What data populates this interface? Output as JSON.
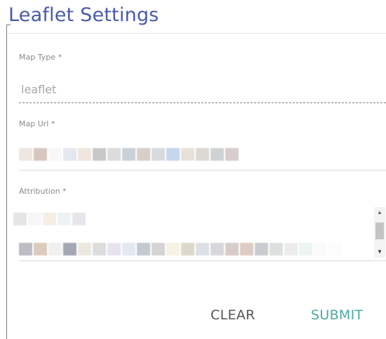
{
  "dialog": {
    "title": "Leaflet Settings"
  },
  "form": {
    "map_type": {
      "label": "Map Type *",
      "value": "leaflet"
    },
    "map_url": {
      "label": "Map Url *"
    },
    "attribution": {
      "label": "Attribution *"
    }
  },
  "actions": {
    "clear_label": "CLEAR",
    "submit_label": "SUBMIT"
  },
  "colors": {
    "title": "#4a5aa8",
    "submit": "#4aa9a1",
    "clear": "#555555"
  },
  "redacted": {
    "map_url_swatches": [
      "#eee6e2",
      "#d8c6c0",
      "#f8f8f8",
      "#e4e6f0",
      "#eee6dc",
      "#c8c8c8",
      "#dcdcdc",
      "#c8d0d8",
      "#d8cfc8",
      "#d8dadc",
      "#c6d6ec",
      "#e6e2da",
      "#dcd8d6",
      "#cfd2d4",
      "#d8cccc"
    ],
    "attribution_line1_swatches": [
      "#e4e4e4",
      "#f6f6f6",
      "#f4eee4",
      "#eef2f4",
      "#e6e6ea"
    ],
    "attribution_line2_swatches": [
      "#bcbcc4",
      "#dacbbc",
      "#f0f0f0",
      "#a4a8b4",
      "#ece8e0",
      "#dcdcdc",
      "#e8e2ec",
      "#e4e8f0",
      "#c4c8d0",
      "#d4d4d4",
      "#f4f2e0",
      "#dcd8cc",
      "#dce0e4",
      "#d8d8dc",
      "#d8ccc8",
      "#dcccc4",
      "#c8ccd0",
      "#dce0dc",
      "#ececec",
      "#ecf4f4",
      "#fafafa",
      "#fcfcfc"
    ]
  }
}
